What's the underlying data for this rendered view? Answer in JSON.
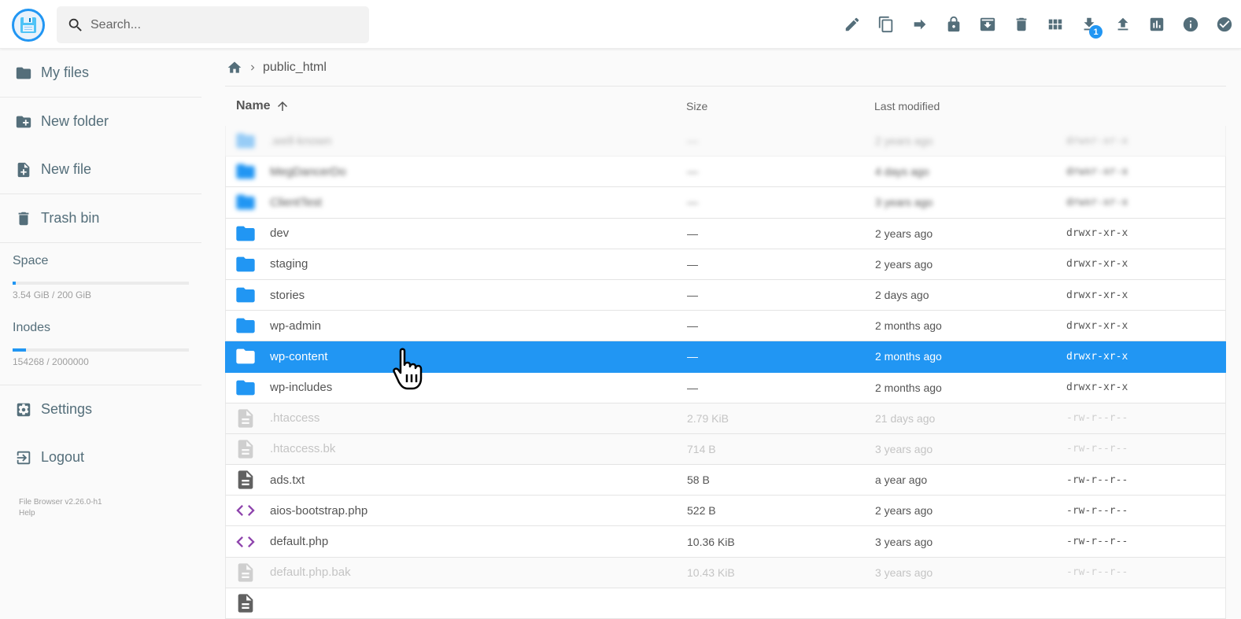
{
  "header": {
    "logo_icon": "floppy-disk-icon",
    "search": {
      "placeholder": "Search...",
      "value": ""
    },
    "actions": [
      {
        "name": "rename",
        "icon": "pencil-icon"
      },
      {
        "name": "copy",
        "icon": "copy-icon"
      },
      {
        "name": "move",
        "icon": "arrow-right-icon"
      },
      {
        "name": "permissions",
        "icon": "lock-icon"
      },
      {
        "name": "archive",
        "icon": "archive-icon"
      },
      {
        "name": "delete",
        "icon": "trash-icon"
      },
      {
        "name": "switch-view",
        "icon": "grid-icon"
      },
      {
        "name": "download",
        "icon": "download-icon",
        "badge": "1"
      },
      {
        "name": "upload",
        "icon": "upload-icon"
      },
      {
        "name": "disk-usage",
        "icon": "bar-chart-icon"
      },
      {
        "name": "info",
        "icon": "info-icon"
      },
      {
        "name": "select-multiple",
        "icon": "check-circle-icon"
      }
    ]
  },
  "sidebar": {
    "items": [
      {
        "label": "My files",
        "icon": "folder-icon"
      },
      {
        "label": "New folder",
        "icon": "folder-plus-icon"
      },
      {
        "label": "New file",
        "icon": "file-plus-icon"
      },
      {
        "label": "Trash bin",
        "icon": "trash-icon"
      }
    ],
    "space": {
      "title": "Space",
      "value": "3.54 GiB / 200 GiB",
      "fraction": 0.0177
    },
    "inodes": {
      "title": "Inodes",
      "value": "154268 / 2000000",
      "fraction": 0.0771
    },
    "settings_label": "Settings",
    "logout_label": "Logout",
    "version": "File Browser v2.26.0-h1",
    "help": "Help"
  },
  "breadcrumb": {
    "home_icon": "home-icon",
    "path": [
      "public_html"
    ]
  },
  "table": {
    "columns": {
      "name": "Name",
      "size": "Size",
      "modified": "Last modified"
    },
    "sort": {
      "column": "name",
      "direction": "ascending"
    },
    "rows": [
      {
        "name": ".well-known",
        "size": "—",
        "modified": "2 years ago",
        "perm": "drwxr-xr-x",
        "type": "folder",
        "state": "blurred-hidden"
      },
      {
        "name": "MegDancerDo",
        "size": "—",
        "modified": "4 days ago",
        "perm": "drwxr-xr-x",
        "type": "folder",
        "state": "blurred"
      },
      {
        "name": "ClientTest",
        "size": "—",
        "modified": "3 years ago",
        "perm": "drwxr-xr-x",
        "type": "folder",
        "state": "blurred"
      },
      {
        "name": "dev",
        "size": "—",
        "modified": "2 years ago",
        "perm": "drwxr-xr-x",
        "type": "folder",
        "state": "normal"
      },
      {
        "name": "staging",
        "size": "—",
        "modified": "2 years ago",
        "perm": "drwxr-xr-x",
        "type": "folder",
        "state": "normal"
      },
      {
        "name": "stories",
        "size": "—",
        "modified": "2 days ago",
        "perm": "drwxr-xr-x",
        "type": "folder",
        "state": "normal"
      },
      {
        "name": "wp-admin",
        "size": "—",
        "modified": "2 months ago",
        "perm": "drwxr-xr-x",
        "type": "folder",
        "state": "normal"
      },
      {
        "name": "wp-content",
        "size": "—",
        "modified": "2 months ago",
        "perm": "drwxr-xr-x",
        "type": "folder",
        "state": "selected"
      },
      {
        "name": "wp-includes",
        "size": "—",
        "modified": "2 months ago",
        "perm": "drwxr-xr-x",
        "type": "folder",
        "state": "normal"
      },
      {
        "name": ".htaccess",
        "size": "2.79 KiB",
        "modified": "21 days ago",
        "perm": "-rw-r--r--",
        "type": "text",
        "state": "hidden"
      },
      {
        "name": ".htaccess.bk",
        "size": "714 B",
        "modified": "3 years ago",
        "perm": "-rw-r--r--",
        "type": "text",
        "state": "hidden"
      },
      {
        "name": "ads.txt",
        "size": "58 B",
        "modified": "a year ago",
        "perm": "-rw-r--r--",
        "type": "text",
        "state": "normal"
      },
      {
        "name": "aios-bootstrap.php",
        "size": "522 B",
        "modified": "2 years ago",
        "perm": "-rw-r--r--",
        "type": "code",
        "state": "normal"
      },
      {
        "name": "default.php",
        "size": "10.36 KiB",
        "modified": "3 years ago",
        "perm": "-rw-r--r--",
        "type": "code",
        "state": "normal"
      },
      {
        "name": "default.php.bak",
        "size": "10.43 KiB",
        "modified": "3 years ago",
        "perm": "-rw-r--r--",
        "type": "text",
        "state": "hidden"
      },
      {
        "name": "",
        "size": "",
        "modified": "",
        "perm": "",
        "type": "text",
        "state": "normal"
      }
    ]
  },
  "colors": {
    "accent": "#2196f3",
    "icon": "#546e7a",
    "code_icon": "#8e44ad",
    "text_file_icon": "#616161"
  },
  "cursor_icon": "hand-pointer-icon"
}
